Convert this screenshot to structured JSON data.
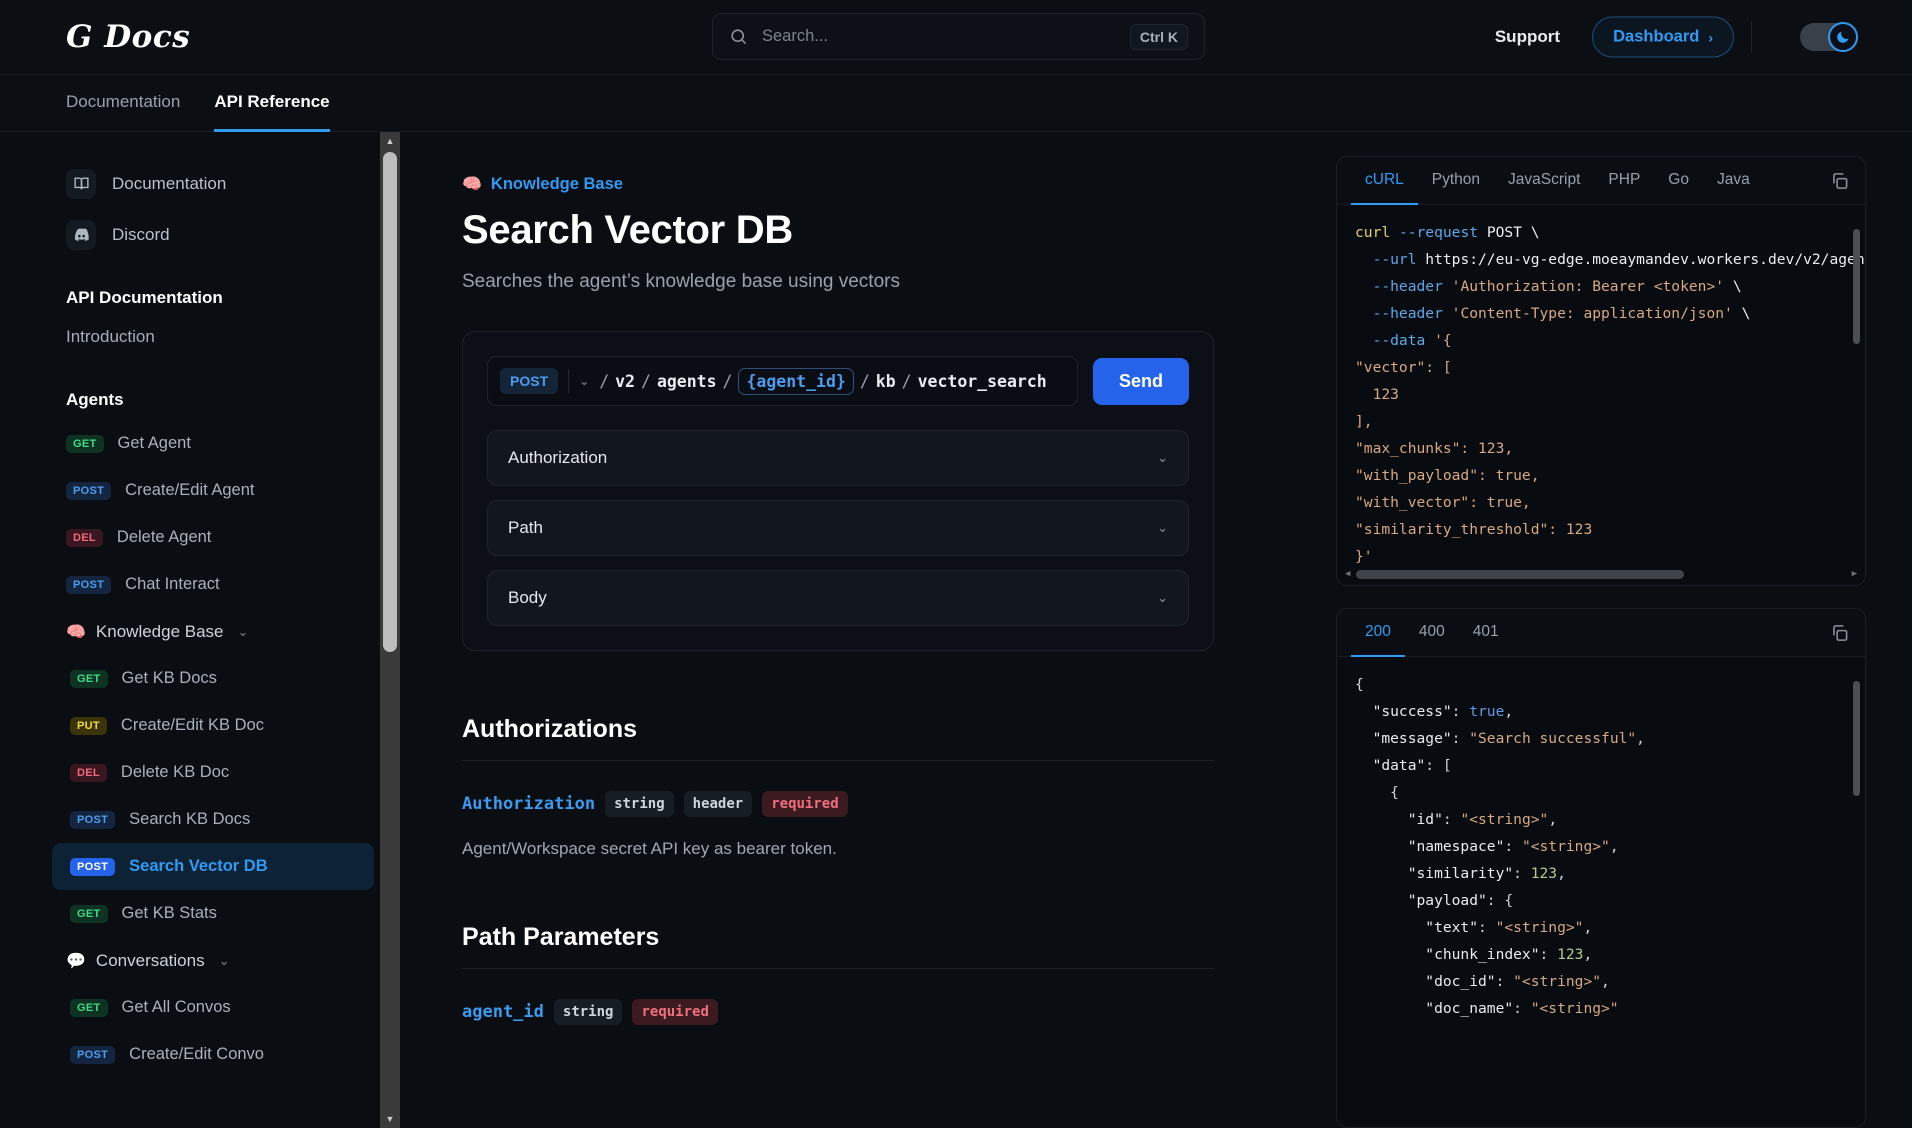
{
  "header": {
    "logo": "G Docs",
    "search": {
      "placeholder": "Search...",
      "shortcut": "Ctrl K",
      "icon": "search-icon"
    },
    "support_label": "Support",
    "dashboard_label": "Dashboard",
    "dashboard_chevron": "›",
    "theme_toggle_icon": "moon-icon"
  },
  "nav_tabs": [
    {
      "label": "Documentation",
      "active": false
    },
    {
      "label": "API Reference",
      "active": true
    }
  ],
  "sidebar": {
    "links": [
      {
        "label": "Documentation",
        "icon": "book-icon"
      },
      {
        "label": "Discord",
        "icon": "discord-icon"
      }
    ],
    "section_heading": "API Documentation",
    "intro_label": "Introduction",
    "group_heading": "Agents",
    "agents": [
      {
        "method": "GET",
        "label": "Get Agent"
      },
      {
        "method": "POST",
        "label": "Create/Edit Agent"
      },
      {
        "method": "DEL",
        "label": "Delete Agent"
      },
      {
        "method": "POST",
        "label": "Chat Interact"
      }
    ],
    "kb_group": {
      "emoji": "🧠",
      "label": "Knowledge Base",
      "chevron": "⌄"
    },
    "kb_items": [
      {
        "method": "GET",
        "label": "Get KB Docs",
        "active": false
      },
      {
        "method": "PUT",
        "label": "Create/Edit KB Doc",
        "active": false
      },
      {
        "method": "DEL",
        "label": "Delete KB Doc",
        "active": false
      },
      {
        "method": "POST",
        "label": "Search KB Docs",
        "active": false
      },
      {
        "method": "POST",
        "label": "Search Vector DB",
        "active": true
      },
      {
        "method": "GET",
        "label": "Get KB Stats",
        "active": false
      }
    ],
    "convo_group": {
      "emoji": "💬",
      "label": "Conversations",
      "chevron": "⌄"
    },
    "convo_items": [
      {
        "method": "GET",
        "label": "Get All Convos"
      },
      {
        "method": "POST",
        "label": "Create/Edit Convo"
      }
    ]
  },
  "main": {
    "breadcrumb": {
      "emoji": "🧠",
      "label": "Knowledge Base"
    },
    "title": "Search Vector DB",
    "subtitle": "Searches the agent’s knowledge base using vectors",
    "playground": {
      "method": "POST",
      "method_chevron": "⌄",
      "path_segments": [
        "v2",
        "agents",
        "{agent_id}",
        "kb",
        "vector_search"
      ],
      "variable_segment": "{agent_id}",
      "send_label": "Send",
      "accordions": [
        {
          "label": "Authorization",
          "chevron": "⌄"
        },
        {
          "label": "Path",
          "chevron": "⌄"
        },
        {
          "label": "Body",
          "chevron": "⌄"
        }
      ]
    },
    "authorizations": {
      "title": "Authorizations",
      "param_name": "Authorization",
      "tags": [
        "string",
        "header"
      ],
      "required_tag": "required",
      "description": "Agent/Workspace secret API key as bearer token."
    },
    "path_parameters": {
      "title": "Path Parameters",
      "param_name": "agent_id",
      "tags": [
        "string"
      ],
      "required_tag": "required"
    }
  },
  "code_panel": {
    "language_tabs": [
      {
        "label": "cURL",
        "active": true
      },
      {
        "label": "Python",
        "active": false
      },
      {
        "label": "JavaScript",
        "active": false
      },
      {
        "label": "PHP",
        "active": false
      },
      {
        "label": "Go",
        "active": false
      },
      {
        "label": "Java",
        "active": false
      }
    ],
    "copy_icon": "copy-icon",
    "request_code_lines": [
      [
        {
          "t": "curl ",
          "c": "k-cmd"
        },
        {
          "t": "--request ",
          "c": "k-flag"
        },
        {
          "t": "POST \\",
          "c": "k-plain"
        }
      ],
      [
        {
          "t": "  --url ",
          "c": "k-flag"
        },
        {
          "t": "https://eu-vg-edge.moeaymandev.workers.dev/v2/agen",
          "c": "k-plain"
        }
      ],
      [
        {
          "t": "  --header ",
          "c": "k-flag"
        },
        {
          "t": "'Authorization: Bearer <token>'",
          "c": "k-str"
        },
        {
          "t": " \\",
          "c": "k-plain"
        }
      ],
      [
        {
          "t": "  --header ",
          "c": "k-flag"
        },
        {
          "t": "'Content-Type: application/json'",
          "c": "k-str"
        },
        {
          "t": " \\",
          "c": "k-plain"
        }
      ],
      [
        {
          "t": "  --data ",
          "c": "k-flag"
        },
        {
          "t": "'{",
          "c": "k-str"
        }
      ],
      [
        {
          "t": "\"vector\": [",
          "c": "k-str"
        }
      ],
      [
        {
          "t": "  123",
          "c": "k-str"
        }
      ],
      [
        {
          "t": "],",
          "c": "k-str"
        }
      ],
      [
        {
          "t": "\"max_chunks\": 123,",
          "c": "k-str"
        }
      ],
      [
        {
          "t": "\"with_payload\": true,",
          "c": "k-str"
        }
      ],
      [
        {
          "t": "\"with_vector\": true,",
          "c": "k-str"
        }
      ],
      [
        {
          "t": "\"similarity_threshold\": 123",
          "c": "k-str"
        }
      ],
      [
        {
          "t": "}'",
          "c": "k-str"
        }
      ]
    ],
    "response_tabs": [
      {
        "label": "200",
        "active": true
      },
      {
        "label": "400",
        "active": false
      },
      {
        "label": "401",
        "active": false
      }
    ],
    "response_code_lines": [
      [
        {
          "t": "{",
          "c": "k-punct"
        }
      ],
      [
        {
          "t": "  \"success\"",
          "c": "k-key"
        },
        {
          "t": ": ",
          "c": "k-punct"
        },
        {
          "t": "true",
          "c": "k-bool"
        },
        {
          "t": ",",
          "c": "k-punct"
        }
      ],
      [
        {
          "t": "  \"message\"",
          "c": "k-key"
        },
        {
          "t": ": ",
          "c": "k-punct"
        },
        {
          "t": "\"Search successful\"",
          "c": "k-str"
        },
        {
          "t": ",",
          "c": "k-punct"
        }
      ],
      [
        {
          "t": "  \"data\"",
          "c": "k-key"
        },
        {
          "t": ": [",
          "c": "k-punct"
        }
      ],
      [
        {
          "t": "    {",
          "c": "k-punct"
        }
      ],
      [
        {
          "t": "      \"id\"",
          "c": "k-key"
        },
        {
          "t": ": ",
          "c": "k-punct"
        },
        {
          "t": "\"<string>\"",
          "c": "k-str"
        },
        {
          "t": ",",
          "c": "k-punct"
        }
      ],
      [
        {
          "t": "      \"namespace\"",
          "c": "k-key"
        },
        {
          "t": ": ",
          "c": "k-punct"
        },
        {
          "t": "\"<string>\"",
          "c": "k-str"
        },
        {
          "t": ",",
          "c": "k-punct"
        }
      ],
      [
        {
          "t": "      \"similarity\"",
          "c": "k-key"
        },
        {
          "t": ": ",
          "c": "k-punct"
        },
        {
          "t": "123",
          "c": "k-num"
        },
        {
          "t": ",",
          "c": "k-punct"
        }
      ],
      [
        {
          "t": "      \"payload\"",
          "c": "k-key"
        },
        {
          "t": ": {",
          "c": "k-punct"
        }
      ],
      [
        {
          "t": "        \"text\"",
          "c": "k-key"
        },
        {
          "t": ": ",
          "c": "k-punct"
        },
        {
          "t": "\"<string>\"",
          "c": "k-str"
        },
        {
          "t": ",",
          "c": "k-punct"
        }
      ],
      [
        {
          "t": "        \"chunk_index\"",
          "c": "k-key"
        },
        {
          "t": ": ",
          "c": "k-punct"
        },
        {
          "t": "123",
          "c": "k-num"
        },
        {
          "t": ",",
          "c": "k-punct"
        }
      ],
      [
        {
          "t": "        \"doc_id\"",
          "c": "k-key"
        },
        {
          "t": ": ",
          "c": "k-punct"
        },
        {
          "t": "\"<string>\"",
          "c": "k-str"
        },
        {
          "t": ",",
          "c": "k-punct"
        }
      ],
      [
        {
          "t": "        \"doc_name\"",
          "c": "k-key"
        },
        {
          "t": ": ",
          "c": "k-punct"
        },
        {
          "t": "\"<string>\"",
          "c": "k-str"
        }
      ]
    ]
  },
  "colors": {
    "accent_blue": "#2f9bf5",
    "send_blue": "#2563eb",
    "get_green": "#3ddb84",
    "post_blue": "#4c9df0",
    "del_red": "#f0697d",
    "put_yellow": "#f5d93a",
    "page_bg": "#0a0d12"
  }
}
